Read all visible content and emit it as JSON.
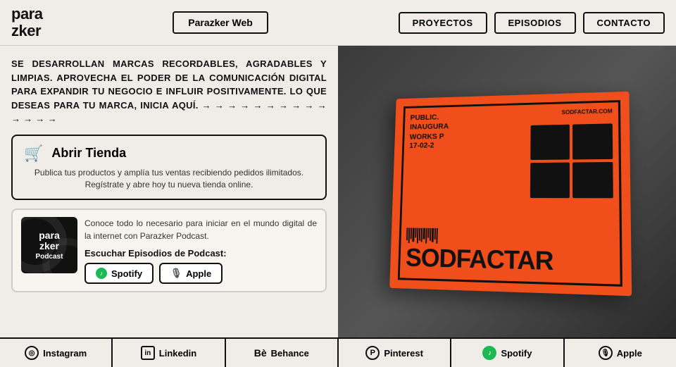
{
  "header": {
    "logo_line1": "para",
    "logo_line2": "zker",
    "parazker_web_label": "Parazker Web",
    "nav": {
      "proyectos": "PROYECTOS",
      "episodios": "EPISODIOS",
      "contacto": "CONTACTO"
    }
  },
  "main": {
    "hero_text": "SE DESARROLLAN MARCAS RECORDABLES, AGRADABLES Y LIMPIAS. APROVECHA EL PODER DE LA COMUNICACIÓN DIGITAL PARA EXPANDIR TU NEGOCIO E INFLUIR POSITIVAMENTE. LO QUE DESEAS PARA TU MARCA, INICIA AQUÍ. → → → → → → → → → → → → → →",
    "shop_card": {
      "title": "Abrir Tienda",
      "description": "Publica tus productos y amplía tus ventas recibiendo pedidos ilimitados. Regístrate y abre hoy tu nueva tienda online."
    },
    "podcast_card": {
      "logo_line1": "para",
      "logo_line2": "zker",
      "logo_sub": "Podcast",
      "description": "Conoce todo lo necesario para iniciar en el mundo digital de la internet con Parazker Podcast.",
      "listen_label": "Escuchar Episodios de Podcast:",
      "spotify_label": "Spotify",
      "apple_label": "Apple"
    }
  },
  "footer": {
    "items": [
      {
        "icon": "instagram",
        "label": "Instagram"
      },
      {
        "icon": "linkedin",
        "label": "Linkedin"
      },
      {
        "icon": "behance",
        "label": "Behance"
      },
      {
        "icon": "pinterest",
        "label": "Pinterest"
      },
      {
        "icon": "spotify",
        "label": "Spotify"
      },
      {
        "icon": "apple",
        "label": "Apple"
      }
    ]
  }
}
